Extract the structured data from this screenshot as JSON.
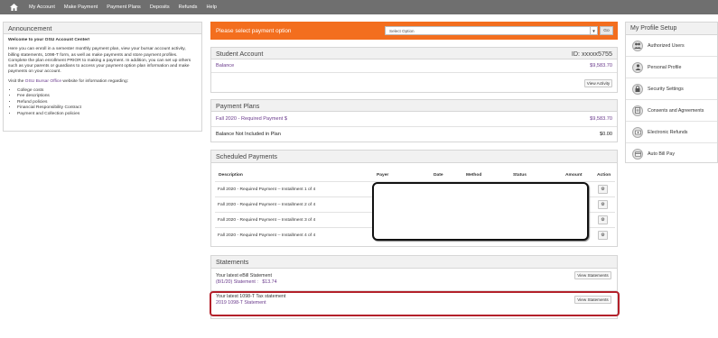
{
  "nav": {
    "items": [
      "My Account",
      "Make Payment",
      "Payment Plans",
      "Deposits",
      "Refunds",
      "Help"
    ]
  },
  "announcement": {
    "title": "Announcement",
    "welcome": "Welcome to your OSU Account Center!",
    "body": "Here you can enroll in a semester monthly payment plan, view your bursar account activity, billing statements, 1098-T form, as well as make payments and store payment profiles. Complete the plan enrollment PRIOR to making a payment. In addition, you can set up others such as your parents or guardians to access your payment option plan information and make payments on your account.",
    "visit_pre": "Visit the ",
    "visit_link": "OSU Bursar Office",
    "visit_post": " website for information regarding:",
    "list": [
      "College costs",
      "Fee descriptions",
      "Refund policies",
      "Financial Responsibility Contract",
      "Payment and Collection policies"
    ]
  },
  "payment_option": {
    "prompt": "Please select payment option",
    "select_value": "Select Option",
    "go_label": "Go",
    "bar_color": "#f36e1e"
  },
  "student_account": {
    "title": "Student Account",
    "id_label": "ID: xxxxx5755",
    "balance_label": "Balance",
    "balance_value": "$9,583.70",
    "view_activity_label": "View Activity"
  },
  "payment_plans": {
    "title": "Payment Plans",
    "plan_label": "Fall 2020 - Required Payment $",
    "plan_value": "$9,583.70",
    "not_in_plan_label": "Balance Not Included in Plan",
    "not_in_plan_value": "$0.00"
  },
  "scheduled_payments": {
    "title": "Scheduled Payments",
    "columns": [
      "Description",
      "Payer",
      "Date",
      "Method",
      "Status",
      "Amount",
      "Action"
    ],
    "rows": [
      "Fall 2020 - Required Payment -- Installment 1 of 4",
      "Fall 2020 - Required Payment -- Installment 2 of 4",
      "Fall 2020 - Required Payment -- Installment 3 of 4",
      "Fall 2020 - Required Payment -- Installment 4 of 4"
    ]
  },
  "statements": {
    "title": "Statements",
    "ebill_label": "Your latest eBill Statement",
    "ebill_link": "(8/1/20) Statement :",
    "ebill_amount": "$13.74",
    "view_statements_label": "View Statements",
    "tax_label": "Your latest 1098-T Tax statement",
    "tax_link": "2019 1098-T Statement",
    "highlight_color": "#b3202a"
  },
  "profile": {
    "title": "My Profile Setup",
    "items": [
      {
        "label": "Authorized Users",
        "icon": "users-icon"
      },
      {
        "label": "Personal Profile",
        "icon": "person-icon"
      },
      {
        "label": "Security Settings",
        "icon": "lock-icon"
      },
      {
        "label": "Consents and Agreements",
        "icon": "document-icon"
      },
      {
        "label": "Electronic Refunds",
        "icon": "refund-icon"
      },
      {
        "label": "Auto Bill Pay",
        "icon": "card-icon"
      }
    ]
  }
}
